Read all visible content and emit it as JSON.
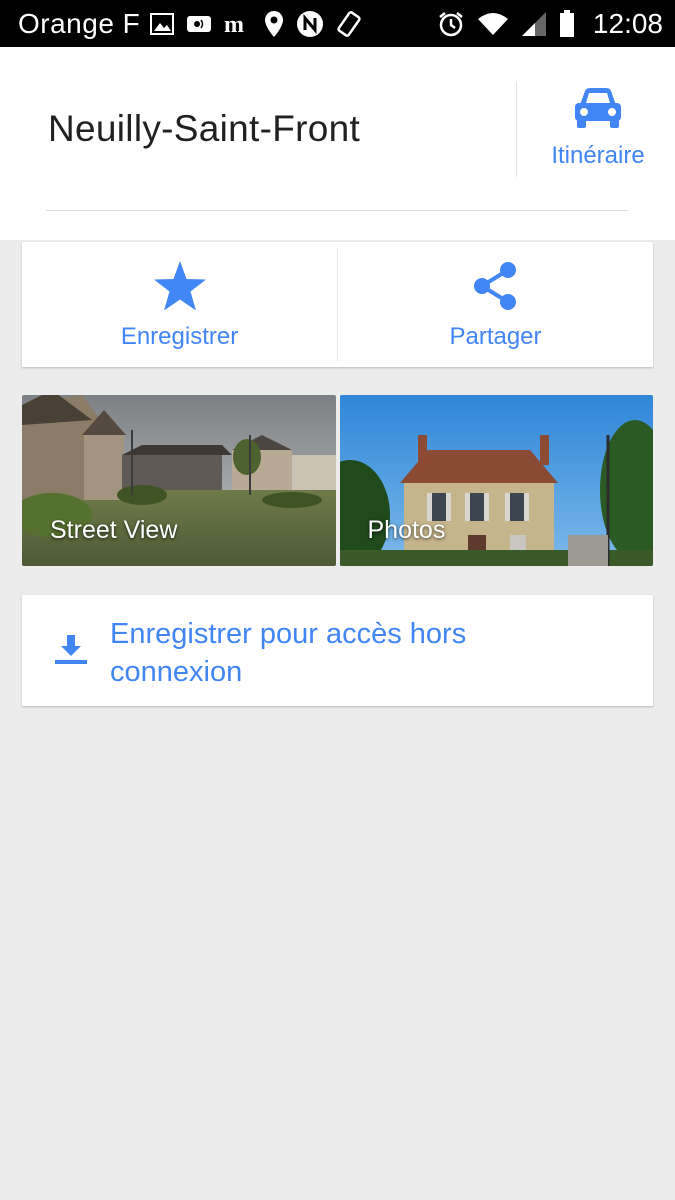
{
  "status_bar": {
    "carrier": "Orange F",
    "time": "12:08"
  },
  "place": {
    "title": "Neuilly-Saint-Front"
  },
  "route": {
    "label": "Itinéraire",
    "icon": "car-icon"
  },
  "actions": [
    {
      "label": "Enregistrer",
      "icon": "star-icon"
    },
    {
      "label": "Partager",
      "icon": "share-icon"
    }
  ],
  "media": [
    {
      "label": "Street View"
    },
    {
      "label": "Photos"
    }
  ],
  "offline": {
    "label": "Enregistrer pour accès hors connexion",
    "icon": "download-icon"
  },
  "colors": {
    "accent": "#4285f4",
    "background": "#ececec",
    "status_bar": "#000000"
  }
}
